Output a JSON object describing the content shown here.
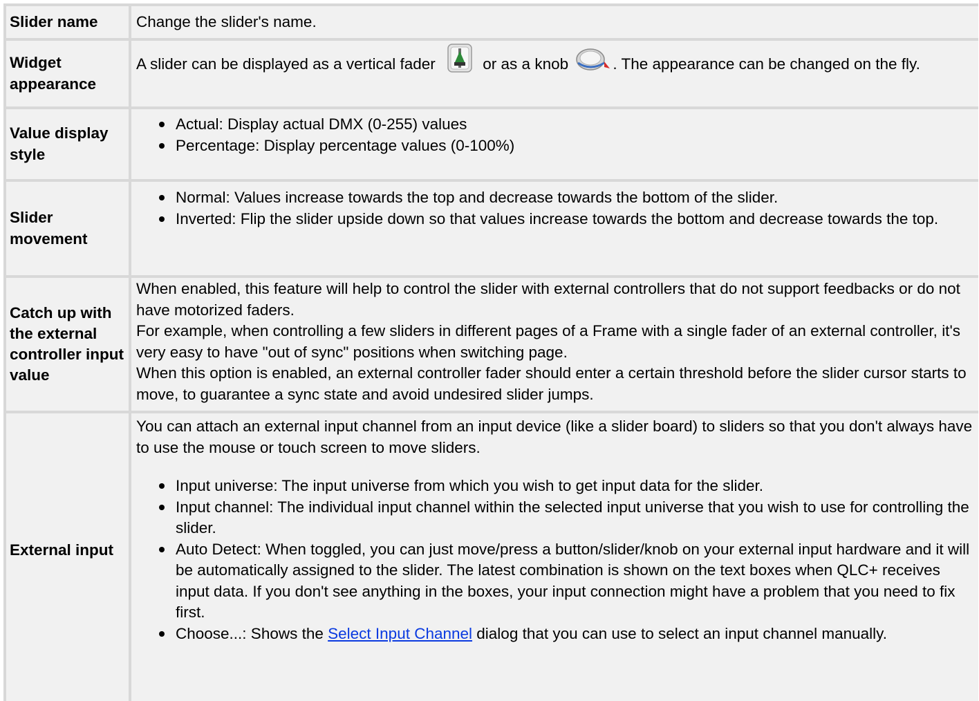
{
  "rows": [
    {
      "name": "Slider name",
      "text": "Change the slider's name."
    },
    {
      "name": "Widget appearance",
      "text_a": "A slider can be displayed as a vertical fader",
      "text_b": "or as a knob",
      "text_c": ". The appearance can be changed on the fly.",
      "icons": [
        "vertical-fader-icon",
        "knob-icon"
      ]
    },
    {
      "name": "Value display style",
      "items": [
        "Actual: Display actual DMX (0-255) values",
        "Percentage: Display percentage values (0-100%)"
      ]
    },
    {
      "name": "Slider movement",
      "items": [
        "Normal: Values increase towards the top and decrease towards the bottom of the slider.",
        "Inverted: Flip the slider upside down so that values increase towards the bottom and decrease towards the top."
      ]
    },
    {
      "name": "Catch up with the external controller input value",
      "paragraphs": [
        "When enabled, this feature will help to control the slider with external controllers that do not support feedbacks or do not have motorized faders.",
        "For example, when controlling a few sliders in different pages of a Frame with a single fader of an external controller, it's very easy to have \"out of sync\" positions when switching page.",
        "When this option is enabled, an external controller fader should enter a certain threshold before the slider cursor starts to move, to guarantee a sync state and avoid undesired slider jumps."
      ]
    },
    {
      "name": "External input",
      "intro": "You can attach an external input channel from an input device (like a slider board) to sliders so that you don't always have to use the mouse or touch screen to move sliders.",
      "items": [
        "Input universe: The input universe from which you wish to get input data for the slider.",
        "Input channel: The individual input channel within the selected input universe that you wish to use for controlling the slider.",
        "Auto Detect: When toggled, you can just move/press a button/slider/knob on your external input hardware and it will be automatically assigned to the slider. The latest combination is shown on the text boxes when QLC+ receives input data. If you don't see anything in the boxes, your input connection might have a problem that you need to fix first."
      ],
      "choose_prefix": "Choose...: Shows the ",
      "choose_link": "Select Input Channel",
      "choose_suffix": " dialog that you can use to select an input channel manually."
    }
  ],
  "colors": {
    "cell_background": "#f1f1f1",
    "border": "#d8d8d8",
    "link": "#0a3ae0"
  }
}
